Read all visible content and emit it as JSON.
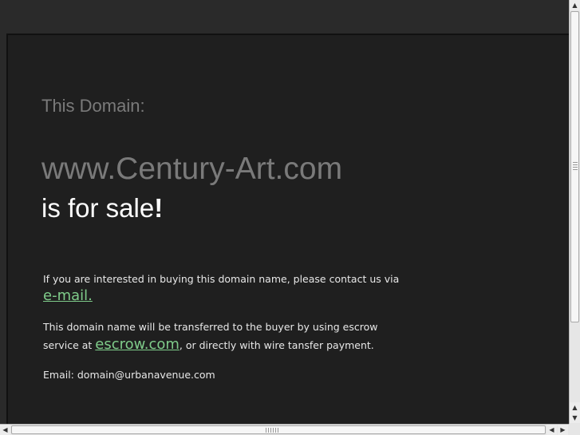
{
  "page": {
    "this_domain_label": "This Domain:",
    "domain_name": "www.Century-Art.com",
    "sale_prefix": "is for sale",
    "sale_suffix": "!",
    "contact_text": "If you are interested in buying this domain name, please contact us via",
    "email_link_label": "e-mail.",
    "transfer_text_1": "This domain name will be transferred to the buyer by using escrow",
    "transfer_text_2_prefix": "service at",
    "escrow_link_label": "escrow.com",
    "transfer_text_2_suffix": ", or directly with wire tansfer payment.",
    "email_line": "Email: domain@urbanavenue.com"
  },
  "scrollbars": {
    "up_arrow": "▲",
    "down_arrow": "▼",
    "left_arrow": "◀",
    "right_arrow": "▶"
  },
  "colors": {
    "background": "#2a2a2a",
    "panel": "#1f1f1f",
    "link": "#7fcc8a",
    "muted_text": "#7a7a7a",
    "text": "#e8e8e8"
  }
}
